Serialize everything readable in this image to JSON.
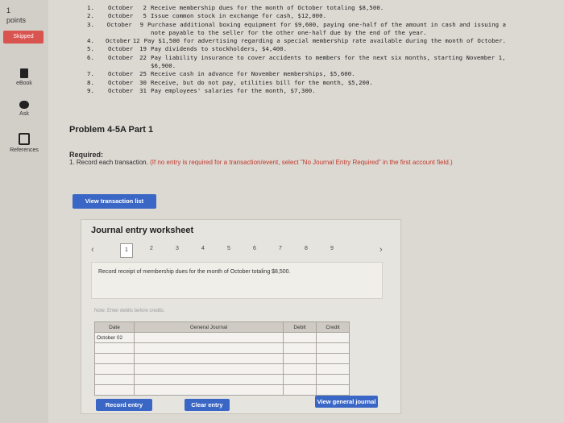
{
  "sidebar": {
    "points_value": "1",
    "points_label": "points",
    "skipped_label": "Skipped",
    "ebook_label": "eBook",
    "ask_label": "Ask",
    "references_label": "References"
  },
  "transactions": [
    {
      "num": "1.",
      "month": "October",
      "day": "2",
      "desc": "Receive membership dues for the month of October totaling $8,500."
    },
    {
      "num": "2.",
      "month": "October",
      "day": "5",
      "desc": "Issue common stock in exchange for cash, $12,000."
    },
    {
      "num": "3.",
      "month": "October",
      "day": "9",
      "desc": "Purchase additional boxing equipment for $9,600, paying one-half of the amount in cash and issuing a",
      "cont": "note payable to the seller for the other one-half due by the end of the year."
    },
    {
      "num": "4.",
      "month": "October",
      "day": "12",
      "desc": "Pay $1,500 for advertising regarding a special membership rate available during the month of October."
    },
    {
      "num": "5.",
      "month": "October",
      "day": "19",
      "desc": "Pay dividends to stockholders, $4,400."
    },
    {
      "num": "6.",
      "month": "October",
      "day": "22",
      "desc": "Pay liability insurance to cover accidents to members for the next six months, starting November 1,",
      "cont": "$6,900."
    },
    {
      "num": "7.",
      "month": "October",
      "day": "25",
      "desc": "Receive cash in advance for November memberships, $5,600."
    },
    {
      "num": "8.",
      "month": "October",
      "day": "30",
      "desc": "Receive, but do not pay, utilities bill for the month, $5,200."
    },
    {
      "num": "9.",
      "month": "October",
      "day": "31",
      "desc": "Pay employees' salaries for the month, $7,300."
    }
  ],
  "problem_title": "Problem 4-5A Part 1",
  "required_label": "Required:",
  "required_text": "1. Record each transaction.",
  "required_hint": "(If no entry is required for a transaction/event, select \"No Journal Entry Required\" in the first account field.)",
  "view_transaction_list": "View transaction list",
  "worksheet": {
    "title": "Journal entry worksheet",
    "pages": [
      "1",
      "2",
      "3",
      "4",
      "5",
      "6",
      "7",
      "8",
      "9"
    ],
    "active_page": "1",
    "prompt": "Record receipt of membership dues for the month of October totaling $8,500.",
    "note": "Note: Enter debits before credits.",
    "columns": {
      "date": "Date",
      "account": "General Journal",
      "debit": "Debit",
      "credit": "Credit"
    },
    "rows": [
      {
        "date": "October 02",
        "account": "",
        "debit": "",
        "credit": ""
      },
      {
        "date": "",
        "account": "",
        "debit": "",
        "credit": ""
      },
      {
        "date": "",
        "account": "",
        "debit": "",
        "credit": ""
      },
      {
        "date": "",
        "account": "",
        "debit": "",
        "credit": ""
      },
      {
        "date": "",
        "account": "",
        "debit": "",
        "credit": ""
      },
      {
        "date": "",
        "account": "",
        "debit": "",
        "credit": ""
      }
    ],
    "record_button": "Record entry",
    "clear_button": "Clear entry",
    "view_journal_button": "View general journal"
  }
}
